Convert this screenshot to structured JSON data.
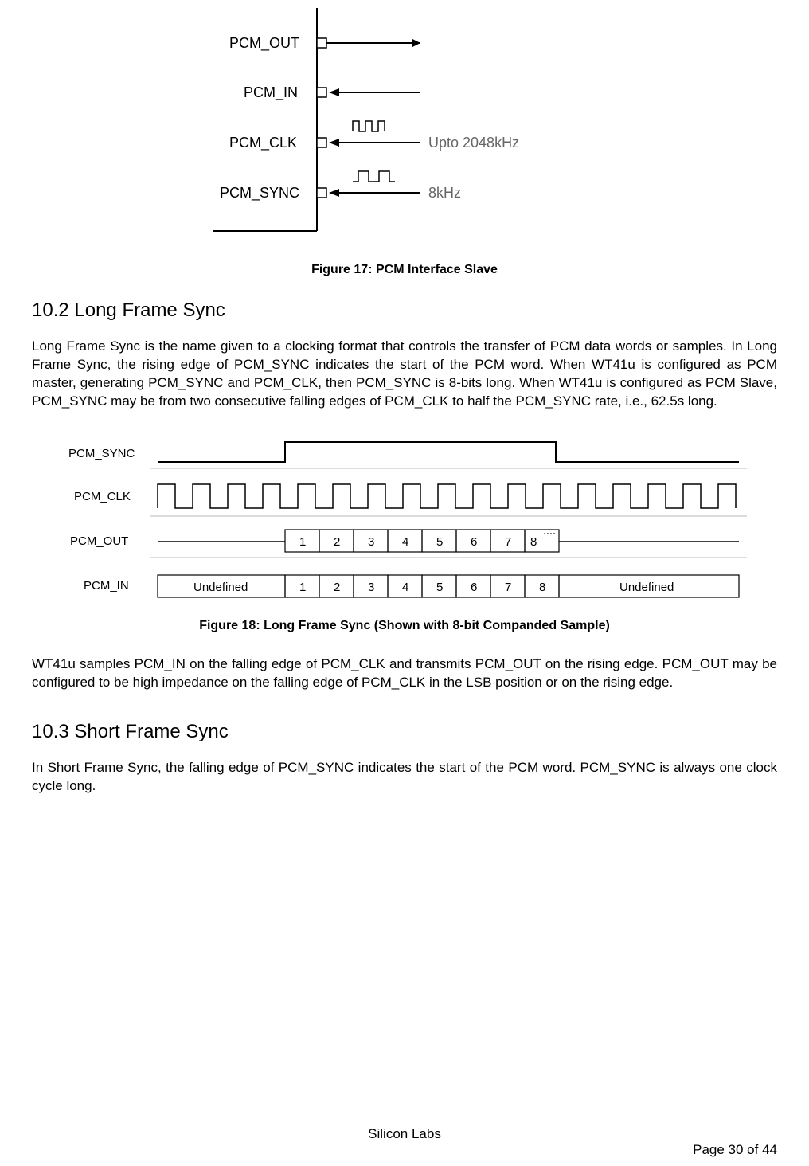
{
  "figure17": {
    "signals": {
      "pcm_out": "PCM_OUT",
      "pcm_in": "PCM_IN",
      "pcm_clk": "PCM_CLK",
      "pcm_sync": "PCM_SYNC"
    },
    "annotations": {
      "clk_rate": "Upto 2048kHz",
      "sync_rate": "8kHz"
    },
    "caption": "Figure 17: PCM Interface Slave"
  },
  "section_10_2": {
    "heading": "10.2 Long Frame Sync",
    "paragraph1": "Long Frame Sync is the name given to a clocking format that controls the transfer of PCM data words or samples. In Long Frame Sync, the rising edge of PCM_SYNC indicates the start of the PCM word. When WT41u is configured as PCM master, generating PCM_SYNC and PCM_CLK, then PCM_SYNC is 8-bits long. When WT41u is configured as PCM Slave, PCM_SYNC may be from two consecutive falling edges of PCM_CLK to half the PCM_SYNC rate, i.e., 62.5s long."
  },
  "figure18": {
    "labels": {
      "pcm_sync": "PCM_SYNC",
      "pcm_clk": "PCM_CLK",
      "pcm_out": "PCM_OUT",
      "pcm_in": "PCM_IN"
    },
    "bits": [
      "1",
      "2",
      "3",
      "4",
      "5",
      "6",
      "7",
      "8"
    ],
    "undefined_label": "Undefined",
    "caption": "Figure 18: Long Frame Sync (Shown with 8-bit Companded Sample)"
  },
  "section_10_2_para2": "WT41u samples PCM_IN on the falling edge of PCM_CLK and transmits PCM_OUT on the rising edge. PCM_OUT may be configured to be high impedance on the falling edge of PCM_CLK in the LSB position or on the rising edge.",
  "section_10_3": {
    "heading": "10.3 Short Frame Sync",
    "paragraph1": "In Short Frame Sync, the falling edge of PCM_SYNC indicates the start of the PCM word. PCM_SYNC is always one clock cycle long."
  },
  "footer": {
    "company": "Silicon Labs",
    "page": "Page 30 of 44"
  }
}
